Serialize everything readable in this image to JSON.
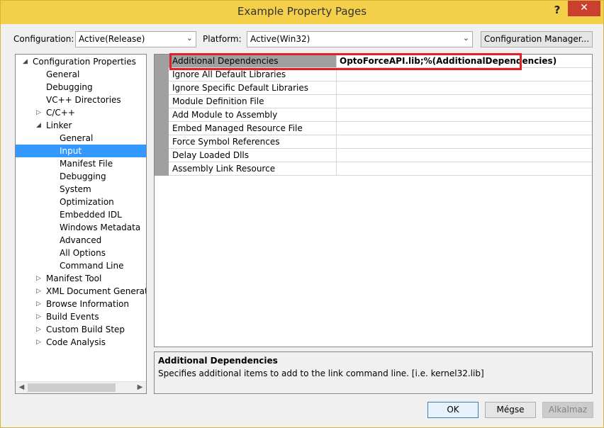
{
  "window": {
    "title": "Example Property Pages",
    "help_label": "?",
    "close_label": "✕"
  },
  "config_bar": {
    "configuration_label": "Configuration:",
    "configuration_value": "Active(Release)",
    "platform_label": "Platform:",
    "platform_value": "Active(Win32)",
    "manager_button": "Configuration Manager..."
  },
  "tree": {
    "items": [
      {
        "label": "Configuration Properties",
        "level": 0,
        "expander": "◢"
      },
      {
        "label": "General",
        "level": 1,
        "expander": ""
      },
      {
        "label": "Debugging",
        "level": 1,
        "expander": ""
      },
      {
        "label": "VC++ Directories",
        "level": 1,
        "expander": ""
      },
      {
        "label": "C/C++",
        "level": 1,
        "expander": "▷"
      },
      {
        "label": "Linker",
        "level": 1,
        "expander": "◢"
      },
      {
        "label": "General",
        "level": 2,
        "expander": ""
      },
      {
        "label": "Input",
        "level": 2,
        "expander": "",
        "selected": true
      },
      {
        "label": "Manifest File",
        "level": 2,
        "expander": ""
      },
      {
        "label": "Debugging",
        "level": 2,
        "expander": ""
      },
      {
        "label": "System",
        "level": 2,
        "expander": ""
      },
      {
        "label": "Optimization",
        "level": 2,
        "expander": ""
      },
      {
        "label": "Embedded IDL",
        "level": 2,
        "expander": ""
      },
      {
        "label": "Windows Metadata",
        "level": 2,
        "expander": ""
      },
      {
        "label": "Advanced",
        "level": 2,
        "expander": ""
      },
      {
        "label": "All Options",
        "level": 2,
        "expander": ""
      },
      {
        "label": "Command Line",
        "level": 2,
        "expander": ""
      },
      {
        "label": "Manifest Tool",
        "level": 1,
        "expander": "▷"
      },
      {
        "label": "XML Document Generator",
        "level": 1,
        "expander": "▷"
      },
      {
        "label": "Browse Information",
        "level": 1,
        "expander": "▷"
      },
      {
        "label": "Build Events",
        "level": 1,
        "expander": "▷"
      },
      {
        "label": "Custom Build Step",
        "level": 1,
        "expander": "▷"
      },
      {
        "label": "Code Analysis",
        "level": 1,
        "expander": "▷"
      }
    ]
  },
  "properties": {
    "rows": [
      {
        "name": "Additional Dependencies",
        "value": "OptoForceAPI.lib;%(AdditionalDependencies)",
        "selected": true
      },
      {
        "name": "Ignore All Default Libraries",
        "value": ""
      },
      {
        "name": "Ignore Specific Default Libraries",
        "value": ""
      },
      {
        "name": "Module Definition File",
        "value": ""
      },
      {
        "name": "Add Module to Assembly",
        "value": ""
      },
      {
        "name": "Embed Managed Resource File",
        "value": ""
      },
      {
        "name": "Force Symbol References",
        "value": ""
      },
      {
        "name": "Delay Loaded Dlls",
        "value": ""
      },
      {
        "name": "Assembly Link Resource",
        "value": ""
      }
    ]
  },
  "description": {
    "title": "Additional Dependencies",
    "text": "Specifies additional items to add to the link command line. [i.e. kernel32.lib]"
  },
  "footer": {
    "ok": "OK",
    "cancel": "Mégse",
    "apply": "Alkalmaz"
  },
  "colors": {
    "titlebar": "#f4cf4a",
    "close_button": "#c9402f",
    "selection": "#3399ff",
    "highlight_box": "#e0202a"
  }
}
